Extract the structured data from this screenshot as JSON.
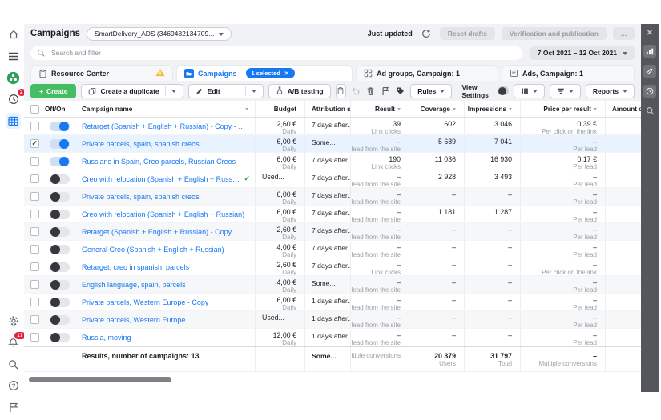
{
  "topbar": {
    "title": "Campaigns",
    "account": "SmartDelivery_ADS (3469482134709...",
    "status": "Just updated",
    "reset_drafts": "Reset drafts",
    "verification": "Verification and publication",
    "more": "...",
    "date_range": "7 Oct 2021 – 12 Oct 2021"
  },
  "search": {
    "placeholder": "Search and filter"
  },
  "tabs": {
    "resource_center": "Resource Center",
    "campaigns": "Campaigns",
    "selected_badge": "1 selected",
    "ad_groups": "Ad groups, Campaign: 1",
    "ads": "Ads, Campaign: 1"
  },
  "toolbar": {
    "create": "Create",
    "duplicate": "Create a duplicate",
    "edit": "Edit",
    "ab_testing": "A/B testing",
    "rules": "Rules",
    "view_settings": "View Settings",
    "reports": "Reports"
  },
  "table": {
    "columns": [
      {
        "label": ""
      },
      {
        "label": "Off/On"
      },
      {
        "label": "Campaign name",
        "sortable": true
      },
      {
        "label": "Budget"
      },
      {
        "label": "Attribution setup"
      },
      {
        "label": "Result",
        "sortable": true
      },
      {
        "label": "Coverage",
        "sortable": true
      },
      {
        "label": "Impressions",
        "sortable": true
      },
      {
        "label": "Price per result",
        "sortable": true
      },
      {
        "label": "Amount of co"
      }
    ],
    "rows": [
      {
        "name": "Retarget (Spanish + English + Russian) - Copy - Copy",
        "toggle": "on",
        "budget": "2,60 €",
        "budget_sub": "Daily",
        "attribution": "7 days after...",
        "result": "39",
        "result_sub": "Link clicks",
        "coverage": "602",
        "impressions": "3 046",
        "price": "0,39 €",
        "price_sub": "Per click on the link"
      },
      {
        "name": "Private parcels, spain, spanish creos",
        "toggle": "on",
        "checked": true,
        "selected": true,
        "budget": "6,00 €",
        "budget_sub": "Daily",
        "attribution": "Some...",
        "result": "–",
        "result_sub": "lead from the site",
        "coverage": "5 689",
        "impressions": "7 041",
        "price": "–",
        "price_sub": "Per lead"
      },
      {
        "name": "Russians in Spain, Creo parcels, Russian Creos",
        "toggle": "on",
        "budget": "6,00 €",
        "budget_sub": "Daily",
        "attribution": "7 days after...",
        "result": "190",
        "result_sub": "Link clicks",
        "coverage": "11 036",
        "impressions": "16 930",
        "price": "0,17 €",
        "price_sub": "Per lead"
      },
      {
        "name": "Creo with relocation (Spanish + English + Russian) - at the group level",
        "toggle": "off",
        "name_check": true,
        "budget": "Used...",
        "budget_sub": "",
        "attribution": "7 days after...",
        "result": "–",
        "result_sub": "lead from the site",
        "coverage": "2 928",
        "impressions": "3 493",
        "price": "–",
        "price_sub": "Per lead"
      },
      {
        "name": "Private parcels, spain, spanish creos",
        "toggle": "off",
        "shaded": true,
        "budget": "6,00 €",
        "budget_sub": "Daily",
        "attribution": "7 days after...",
        "result": "–",
        "result_sub": "lead from the site",
        "coverage": "–",
        "impressions": "–",
        "price": "–",
        "price_sub": "Per lead"
      },
      {
        "name": "Creo with relocation (Spanish + English + Russian)",
        "toggle": "off",
        "budget": "6,00 €",
        "budget_sub": "Daily",
        "attribution": "7 days after...",
        "result": "–",
        "result_sub": "lead from the site",
        "coverage": "1 181",
        "impressions": "1 287",
        "price": "–",
        "price_sub": "Per lead"
      },
      {
        "name": "Retarget (Spanish + English + Russian) - Copy",
        "toggle": "off",
        "shaded": true,
        "budget": "2,60 €",
        "budget_sub": "Daily",
        "attribution": "7 days after...",
        "result": "–",
        "result_sub": "lead from the site",
        "coverage": "–",
        "impressions": "–",
        "price": "–",
        "price_sub": "Per lead"
      },
      {
        "name": "General Creo (Spanish + English + Russian)",
        "toggle": "off",
        "budget": "4,00 €",
        "budget_sub": "Daily",
        "attribution": "7 days after...",
        "result": "–",
        "result_sub": "lead from the site",
        "coverage": "–",
        "impressions": "–",
        "price": "–",
        "price_sub": "Per lead"
      },
      {
        "name": "Retarget, creo in spanish, parcels",
        "toggle": "off",
        "budget": "2,60 €",
        "budget_sub": "Daily",
        "attribution": "7 days after...",
        "result": "–",
        "result_sub": "Link clicks",
        "coverage": "–",
        "impressions": "–",
        "price": "–",
        "price_sub": "Per click on the link"
      },
      {
        "name": "English language, spain, parcels",
        "toggle": "off",
        "shaded": true,
        "budget": "4,00 €",
        "budget_sub": "Daily",
        "attribution": "Some...",
        "result": "–",
        "result_sub": "lead from the site",
        "coverage": "–",
        "impressions": "–",
        "price": "–",
        "price_sub": "Per lead"
      },
      {
        "name": "Private parcels, Western Europe - Copy",
        "toggle": "off",
        "budget": "6,00 €",
        "budget_sub": "Daily",
        "attribution": "1 days after...",
        "result": "–",
        "result_sub": "lead from the site",
        "coverage": "–",
        "impressions": "–",
        "price": "–",
        "price_sub": "Per lead"
      },
      {
        "name": "Private parcels, Western Europe",
        "toggle": "off",
        "shaded": true,
        "budget": "Used...",
        "budget_sub": "",
        "attribution": "1 days after...",
        "result": "–",
        "result_sub": "lead from the site",
        "coverage": "–",
        "impressions": "–",
        "price": "–",
        "price_sub": "Per lead"
      },
      {
        "name": "Russia, moving",
        "toggle": "off",
        "budget": "12,00 €",
        "budget_sub": "Daily",
        "attribution": "1 days after...",
        "result": "–",
        "result_sub": "lead from the site",
        "coverage": "–",
        "impressions": "–",
        "price": "–",
        "price_sub": "Per lead"
      }
    ],
    "totals": {
      "label": "Results, number of campaigns: 13",
      "attribution": "Some...",
      "result": "",
      "result_sub": "Multiple conversions",
      "coverage": "20 379",
      "coverage_sub": "Users",
      "impressions": "31 797",
      "impressions_sub": "Total",
      "price": "–",
      "price_sub": "Multiple conversions"
    }
  },
  "left_rail": {
    "history_badge": "2",
    "notifications_badge": "17"
  },
  "colors": {
    "accent_blue": "#1877f2",
    "green": "#45bd62",
    "warning": "#f7b928",
    "selected_row": "#e9f3ff",
    "rail_dark": "#54565c",
    "badge_red": "#e41e3f"
  }
}
